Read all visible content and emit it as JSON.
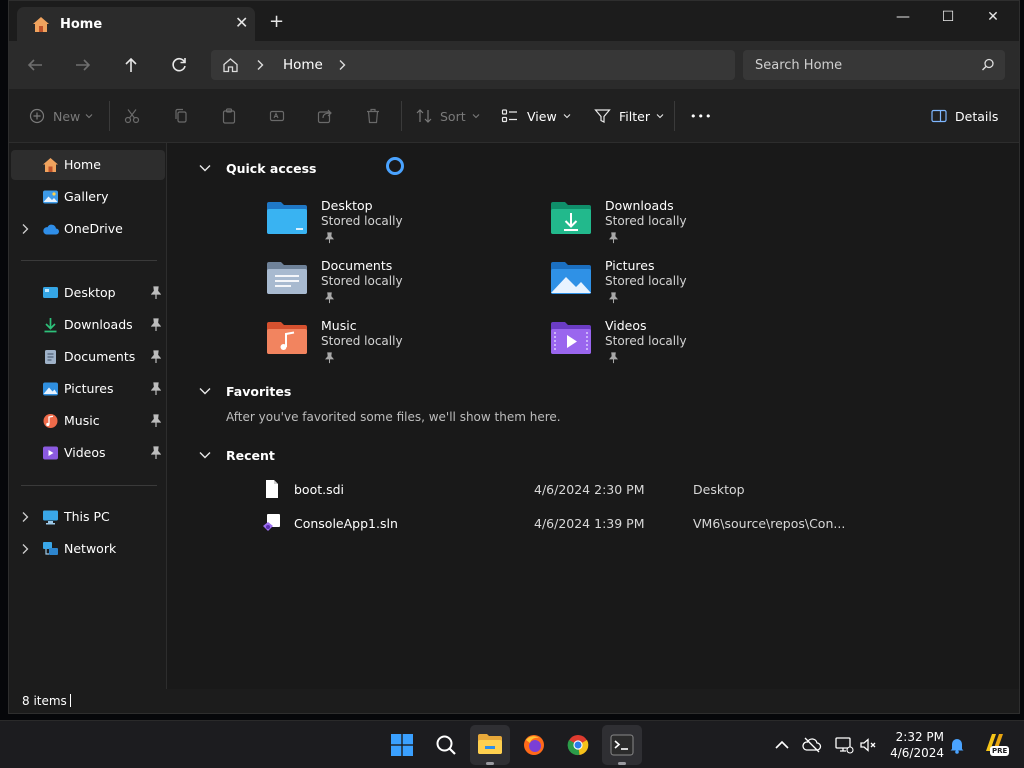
{
  "tab": {
    "title": "Home",
    "close_glyph": "✕",
    "new_tab_glyph": "+"
  },
  "window_controls": {
    "minimize": "—",
    "maximize": "☐",
    "close": "✕"
  },
  "navigation": {
    "breadcrumb": [
      "Home"
    ],
    "search_placeholder": "Search Home"
  },
  "command_bar": {
    "new_label": "New",
    "sort_label": "Sort",
    "view_label": "View",
    "filter_label": "Filter",
    "more_label": "•••",
    "details_label": "Details"
  },
  "sidebar": {
    "top_items": [
      {
        "label": "Home",
        "icon": "home-icon",
        "selected": true
      },
      {
        "label": "Gallery",
        "icon": "gallery-icon"
      },
      {
        "label": "OneDrive",
        "icon": "onedrive-icon",
        "expandable": true
      }
    ],
    "pinned_items": [
      {
        "label": "Desktop",
        "icon": "desktop-icon"
      },
      {
        "label": "Downloads",
        "icon": "downloads-icon"
      },
      {
        "label": "Documents",
        "icon": "documents-icon"
      },
      {
        "label": "Pictures",
        "icon": "pictures-icon"
      },
      {
        "label": "Music",
        "icon": "music-icon"
      },
      {
        "label": "Videos",
        "icon": "videos-icon"
      }
    ],
    "bottom_items": [
      {
        "label": "This PC",
        "icon": "this-pc-icon",
        "expandable": true
      },
      {
        "label": "Network",
        "icon": "network-icon",
        "expandable": true
      }
    ]
  },
  "quick_access": {
    "title": "Quick access",
    "folders": [
      {
        "name": "Desktop",
        "subtitle": "Stored locally",
        "icon": "desktop-folder-icon"
      },
      {
        "name": "Downloads",
        "subtitle": "Stored locally",
        "icon": "downloads-folder-icon"
      },
      {
        "name": "Documents",
        "subtitle": "Stored locally",
        "icon": "documents-folder-icon"
      },
      {
        "name": "Pictures",
        "subtitle": "Stored locally",
        "icon": "pictures-folder-icon"
      },
      {
        "name": "Music",
        "subtitle": "Stored locally",
        "icon": "music-folder-icon"
      },
      {
        "name": "Videos",
        "subtitle": "Stored locally",
        "icon": "videos-folder-icon"
      }
    ]
  },
  "favorites": {
    "title": "Favorites",
    "empty_message": "After you've favorited some files, we'll show them here."
  },
  "recent": {
    "title": "Recent",
    "files": [
      {
        "name": "boot.sdi",
        "date": "4/6/2024 2:30 PM",
        "location": "Desktop",
        "icon": "file-icon"
      },
      {
        "name": "ConsoleApp1.sln",
        "date": "4/6/2024 1:39 PM",
        "location": "VM6\\source\\repos\\Con...",
        "icon": "visual-studio-solution-icon"
      }
    ]
  },
  "status_bar": {
    "item_count": "8 items"
  },
  "taskbar": {
    "apps": [
      "start-icon",
      "search-icon",
      "file-explorer-icon",
      "firefox-icon",
      "chrome-icon",
      "terminal-icon"
    ],
    "time": "2:32 PM",
    "date": "4/6/2024",
    "tray_badge": "PRE"
  },
  "colors": {
    "accent": "#0078d4",
    "window_bg": "#191919",
    "chrome_bg": "#202020",
    "loading_ring": "#4aa3ff"
  }
}
